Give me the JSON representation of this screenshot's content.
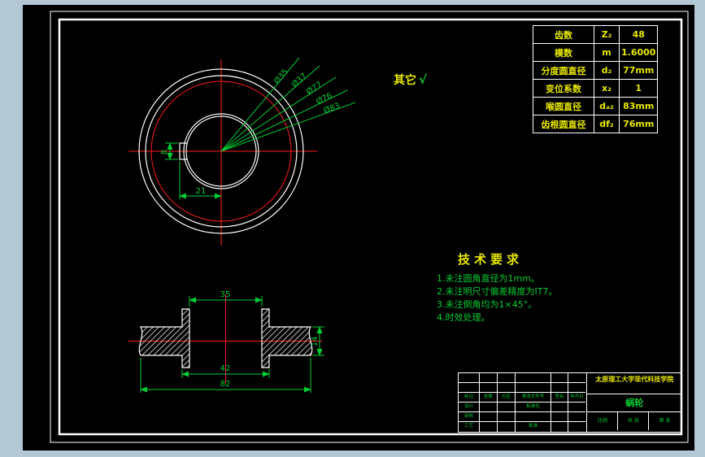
{
  "colors": {
    "background": "#b4c7d5",
    "canvas": "#000000",
    "outline": "#ffffff",
    "dimension": "#00cc33",
    "centerline": "#ff1a1a",
    "accent_text": "#e8e800"
  },
  "param_table": {
    "rows": [
      {
        "label": "齿数",
        "symbol": "Z₂",
        "value": "48"
      },
      {
        "label": "模数",
        "symbol": "m",
        "value": "1.6000"
      },
      {
        "label": "分度圆直径",
        "symbol": "d₂",
        "value": "77mm"
      },
      {
        "label": "变位系数",
        "symbol": "x₂",
        "value": "1"
      },
      {
        "label": "喉圆直径",
        "symbol": "dₐ₂",
        "value": "83mm"
      },
      {
        "label": "齿根圆直径",
        "symbol": "df₂",
        "value": "76mm"
      }
    ]
  },
  "notes": {
    "other": "其它",
    "check": "√"
  },
  "front_view": {
    "radial_labels": [
      "Ø35",
      "Ø37",
      "Ø77",
      "Ø76",
      "Ø83"
    ],
    "keyway_width": "8",
    "keyway_depth": "21"
  },
  "section_view": {
    "bore": "35",
    "hub": "42",
    "overall": "82",
    "face_width": "14"
  },
  "tech_req": {
    "title": "技术要求",
    "items": [
      "1.未注圆角直径为1mm。",
      "2.未注明尺寸偏差精度为IT7。",
      "3.未注倒角均为1×45°。",
      "4.时效处理。"
    ]
  },
  "title_block": {
    "school": "太原理工大学现代科技学院",
    "part": "蜗轮",
    "rev": [
      "标记",
      "处数",
      "分区",
      "更改文件号",
      "签名",
      "年月日"
    ],
    "design": "设计",
    "standard": "标准化",
    "check": "审核",
    "process": "工艺",
    "approve": "批准",
    "scale": "比例",
    "sheet_total": "共 张",
    "sheet_no": "第 张"
  }
}
